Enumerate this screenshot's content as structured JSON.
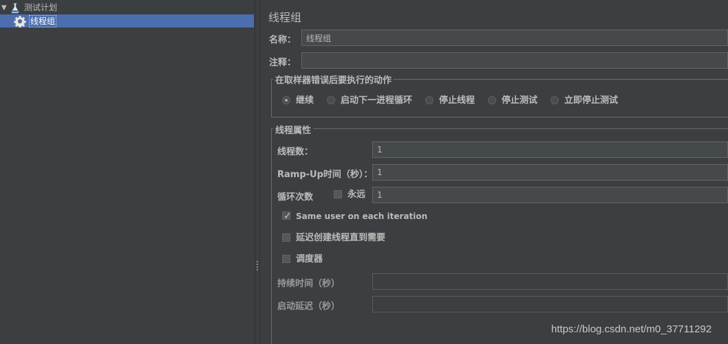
{
  "tree": {
    "root_label": "测试计划",
    "child_label": "线程组"
  },
  "panel": {
    "title": "线程组",
    "name_label": "名称：",
    "name_value": "线程组",
    "comment_label": "注释：",
    "comment_value": ""
  },
  "sampler_error": {
    "title": "在取样器错误后要执行的动作",
    "options": [
      "继续",
      "启动下一进程循环",
      "停止线程",
      "停止测试",
      "立即停止测试"
    ],
    "selected": "继续"
  },
  "thread_props": {
    "title": "线程属性",
    "threads_label": "线程数：",
    "threads_value": "1",
    "rampup_label": "Ramp-Up时间（秒）：",
    "rampup_value": "1",
    "loop_label": "循环次数",
    "forever_label": "永远",
    "forever_checked": false,
    "loop_value": "1",
    "same_user_label": "Same user on each iteration",
    "same_user_checked": true,
    "delay_create_label": "延迟创建线程直到需要",
    "delay_create_checked": false,
    "scheduler_label": "调度器",
    "scheduler_checked": false,
    "duration_label": "持续时间（秒）",
    "duration_value": "",
    "startup_delay_label": "启动延迟（秒）",
    "startup_delay_value": ""
  },
  "watermark": "https://blog.csdn.net/m0_37711292",
  "colors": {
    "background": "#3c3f41",
    "selection": "#4b6eaf",
    "text": "#bbbbbb",
    "input_bg": "#45494a"
  }
}
